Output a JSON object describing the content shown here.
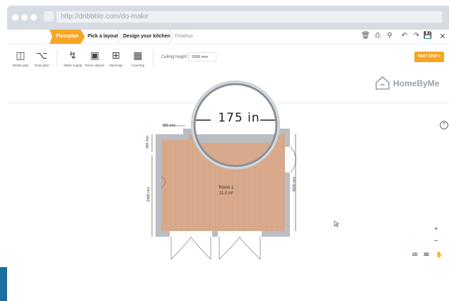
{
  "browser": {
    "url": "http://dribbble.com/do-make"
  },
  "breadcrumbs": [
    {
      "label": "Floorplan",
      "active": true
    },
    {
      "label": "Pick a layout",
      "active": false
    },
    {
      "label": "Design your kitchen",
      "active": false
    },
    {
      "label": "Finalise",
      "active": false
    }
  ],
  "toolbar": {
    "tools": [
      {
        "label": "Initiate plan",
        "icon": "initiate-plan-icon"
      },
      {
        "label": "Draw plan",
        "icon": "draw-plan-icon"
      },
      {
        "label": "Water supply",
        "icon": "water-supply-icon"
      },
      {
        "label": "Room objects",
        "icon": "room-objects-icon"
      },
      {
        "label": "Openings",
        "icon": "openings-icon"
      },
      {
        "label": "Covering",
        "icon": "covering-icon"
      }
    ],
    "ceiling_label": "Ceiling height",
    "ceiling_value": "2500 mm",
    "next_step": "NEXT STEP >"
  },
  "brand": {
    "name": "HomeByMe"
  },
  "plan": {
    "room_name": "Room 1",
    "room_area": "21.0 m²",
    "magnifier_text": "175 in",
    "dim_top_left": "800 mm",
    "dim_left_upper": "800 mm",
    "dim_left": "3489 mm",
    "dim_right": "4045 mm"
  },
  "zoom": {
    "plus": "+",
    "minus": "−"
  },
  "view_modes": {
    "two_d": "2D",
    "three_d": "3D"
  },
  "help": "?",
  "colors": {
    "accent": "#f6a623",
    "floor": "#d8a98a",
    "wall": "#b9bec5"
  }
}
